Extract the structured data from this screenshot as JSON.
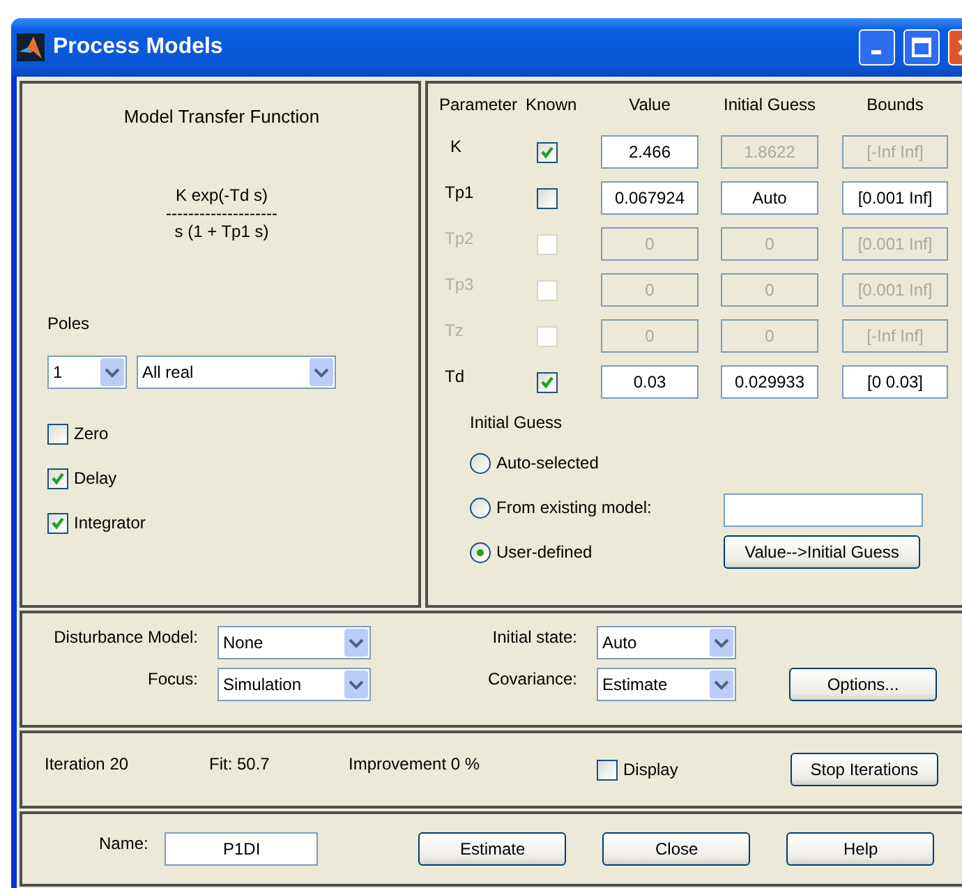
{
  "window": {
    "title": "Process Models"
  },
  "transfer_function": {
    "heading": "Model Transfer Function",
    "numerator": "K exp(-Td s)",
    "divider": "--------------------",
    "denominator": "s (1 + Tp1 s)"
  },
  "poles": {
    "label": "Poles",
    "count": "1",
    "type": "All real"
  },
  "options": [
    {
      "label": "Zero",
      "checked": false
    },
    {
      "label": "Delay",
      "checked": true
    },
    {
      "label": "Integrator",
      "checked": true
    }
  ],
  "parameter_columns": [
    "Parameter",
    "Known",
    "Value",
    "Initial Guess",
    "Bounds"
  ],
  "parameters": [
    {
      "name": "K",
      "known": true,
      "disabled": false,
      "value": "2.466",
      "value_disabled": false,
      "guess": "1.8622",
      "guess_disabled": true,
      "bounds": "[-Inf Inf]",
      "bounds_disabled": true
    },
    {
      "name": "Tp1",
      "known": false,
      "disabled": false,
      "value": "0.067924",
      "value_disabled": false,
      "guess": "Auto",
      "guess_disabled": false,
      "bounds": "[0.001 Inf]",
      "bounds_disabled": false
    },
    {
      "name": "Tp2",
      "known": false,
      "disabled": true,
      "value": "0",
      "value_disabled": true,
      "guess": "0",
      "guess_disabled": true,
      "bounds": "[0.001 Inf]",
      "bounds_disabled": true
    },
    {
      "name": "Tp3",
      "known": false,
      "disabled": true,
      "value": "0",
      "value_disabled": true,
      "guess": "0",
      "guess_disabled": true,
      "bounds": "[0.001 Inf]",
      "bounds_disabled": true
    },
    {
      "name": "Tz",
      "known": false,
      "disabled": true,
      "value": "0",
      "value_disabled": true,
      "guess": "0",
      "guess_disabled": true,
      "bounds": "[-Inf Inf]",
      "bounds_disabled": true
    },
    {
      "name": "Td",
      "known": true,
      "disabled": false,
      "value": "0.03",
      "value_disabled": false,
      "guess": "0.029933",
      "guess_disabled": false,
      "bounds": "[0 0.03]",
      "bounds_disabled": false
    }
  ],
  "initial_guess": {
    "heading": "Initial Guess",
    "choices": [
      {
        "label": "Auto-selected",
        "selected": false
      },
      {
        "label": "From existing model:",
        "selected": false
      },
      {
        "label": "User-defined",
        "selected": true
      }
    ],
    "copy_button": "Value-->Initial Guess"
  },
  "settings": [
    {
      "label": "Disturbance Model:",
      "value": "None"
    },
    {
      "label": "Initial state:",
      "value": "Auto"
    },
    {
      "label": "Focus:",
      "value": "Simulation"
    },
    {
      "label": "Covariance:",
      "value": "Estimate"
    }
  ],
  "options_button": "Options...",
  "status": {
    "iteration": "Iteration 20",
    "fit": "Fit: 50.7",
    "improvement": "Improvement 0 %",
    "display": {
      "label": "Display",
      "checked": false
    },
    "stop_button": "Stop Iterations"
  },
  "name": {
    "label": "Name:",
    "value": "P1DI"
  },
  "buttons": [
    "Estimate",
    "Close",
    "Help"
  ]
}
